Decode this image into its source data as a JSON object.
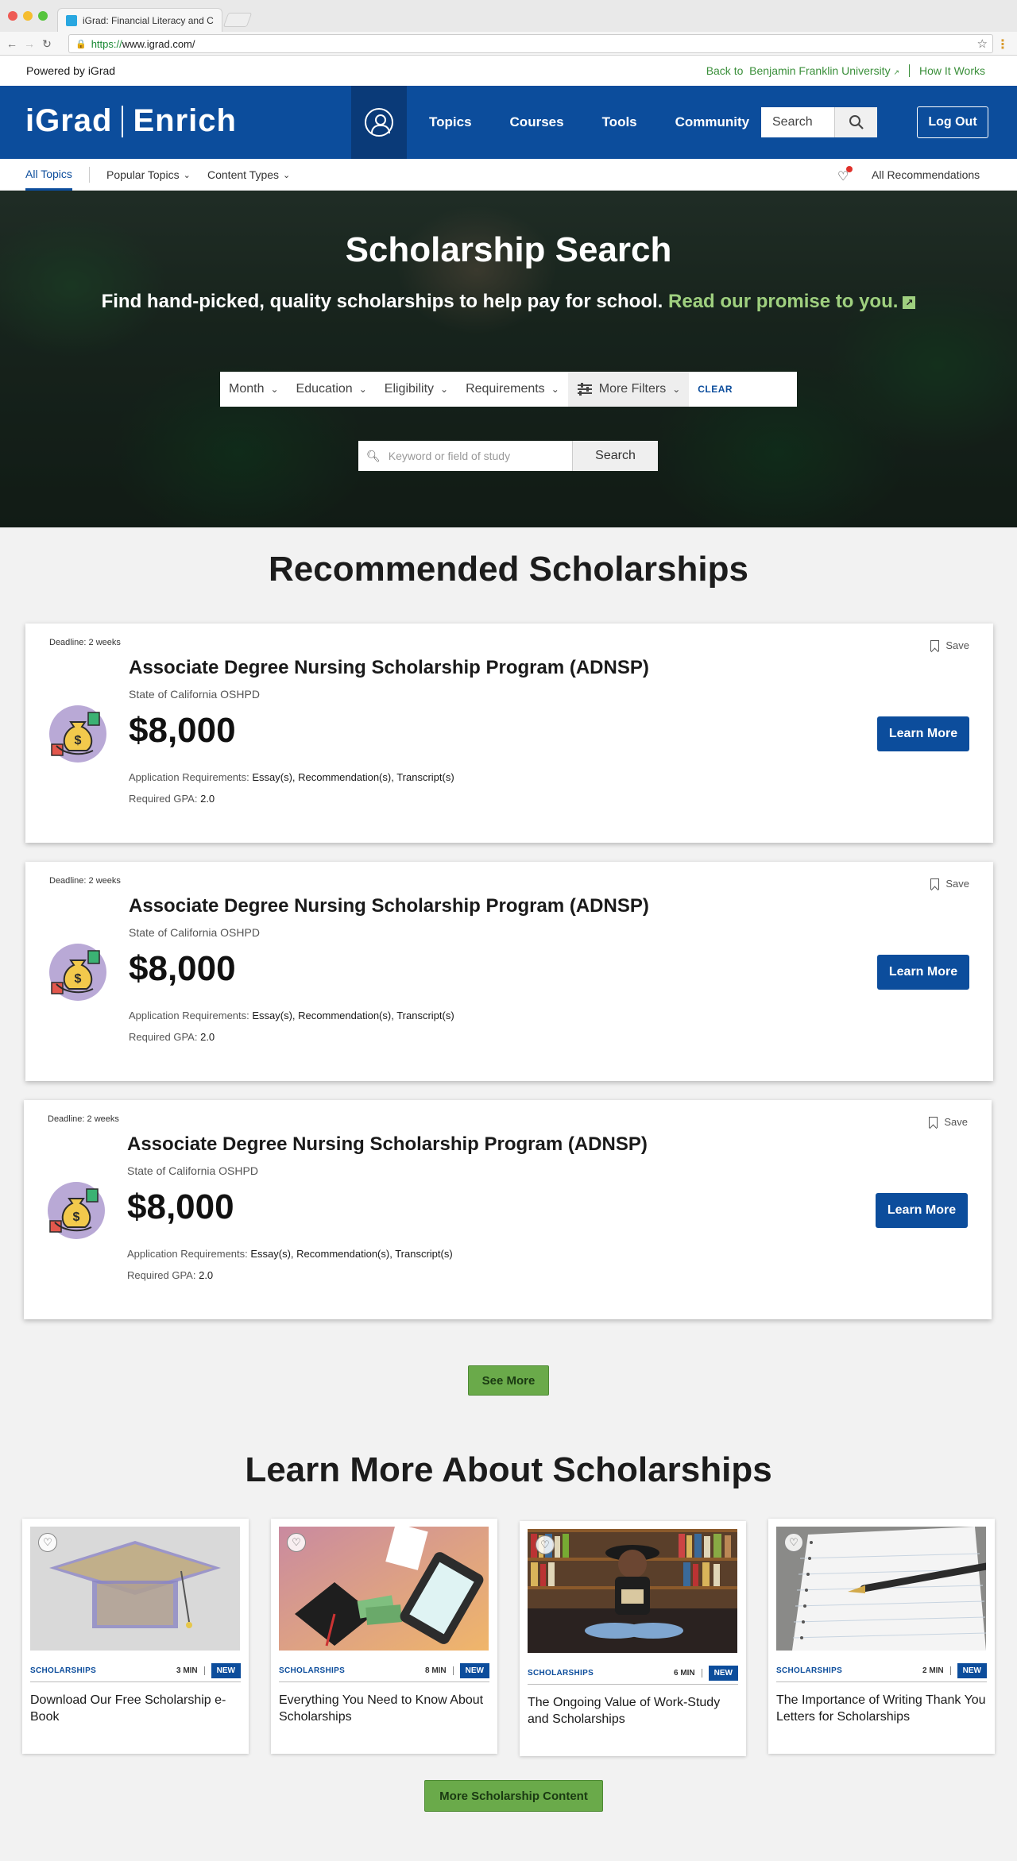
{
  "browser": {
    "tab_title": "iGrad: Financial Literacy and C",
    "url_scheme": "https://",
    "url_host": "www.igrad.com/"
  },
  "powered": {
    "left": "Powered by iGrad",
    "back_to": "Back to",
    "university": "Benjamin Franklin University",
    "how_it_works": "How It Works"
  },
  "nav": {
    "logo_left": "iGrad",
    "logo_right": "Enrich",
    "links": [
      "Topics",
      "Courses",
      "Tools",
      "Community"
    ],
    "search_placeholder": "Search",
    "logout": "Log Out"
  },
  "subnav": {
    "all_topics": "All Topics",
    "popular_topics": "Popular Topics",
    "content_types": "Content Types",
    "all_recommendations": "All Recommendations"
  },
  "hero": {
    "title": "Scholarship Search",
    "subtitle": "Find hand-picked, quality scholarships to help pay for school.",
    "promise": "Read our promise to you.",
    "filters": [
      "Month",
      "Education",
      "Eligibility",
      "Requirements"
    ],
    "more_filters": "More Filters",
    "clear": "CLEAR",
    "search_placeholder": "Keyword or field of study",
    "search_button": "Search"
  },
  "recommended": {
    "title": "Recommended Scholarships",
    "save_label": "Save",
    "learn_more": "Learn More",
    "req_label": "Application Requirements:",
    "gpa_label": "Required GPA:",
    "items": [
      {
        "deadline": "Deadline: 2 weeks",
        "title": "Associate Degree Nursing Scholarship Program (ADNSP)",
        "org": "State of California OSHPD",
        "amount": "$8,000",
        "requirements": "Essay(s), Recommendation(s), Transcript(s)",
        "gpa": "2.0"
      },
      {
        "deadline": "Deadline: 2 weeks",
        "title": "Associate Degree Nursing Scholarship Program (ADNSP)",
        "org": "State of California OSHPD",
        "amount": "$8,000",
        "requirements": "Essay(s), Recommendation(s), Transcript(s)",
        "gpa": "2.0"
      },
      {
        "deadline": "Deadline: 2 weeks",
        "title": "Associate Degree Nursing Scholarship Program (ADNSP)",
        "org": "State of California OSHPD",
        "amount": "$8,000",
        "requirements": "Essay(s), Recommendation(s), Transcript(s)",
        "gpa": "2.0"
      }
    ],
    "see_more": "See More"
  },
  "learn": {
    "title": "Learn More About Scholarships",
    "articles": [
      {
        "category": "SCHOLARSHIPS",
        "minutes": "3 MIN",
        "badge": "NEW",
        "title": "Download Our Free Scholarship e-Book"
      },
      {
        "category": "SCHOLARSHIPS",
        "minutes": "8 MIN",
        "badge": "NEW",
        "title": "Everything You Need to Know About Scholarships"
      },
      {
        "category": "SCHOLARSHIPS",
        "minutes": "6 MIN",
        "badge": "NEW",
        "title": "The Ongoing Value of Work-Study and Scholarships"
      },
      {
        "category": "SCHOLARSHIPS",
        "minutes": "2 MIN",
        "badge": "NEW",
        "title": "The Importance of Writing Thank You Letters for Scholarships"
      }
    ],
    "more_button": "More Scholarship Content"
  }
}
